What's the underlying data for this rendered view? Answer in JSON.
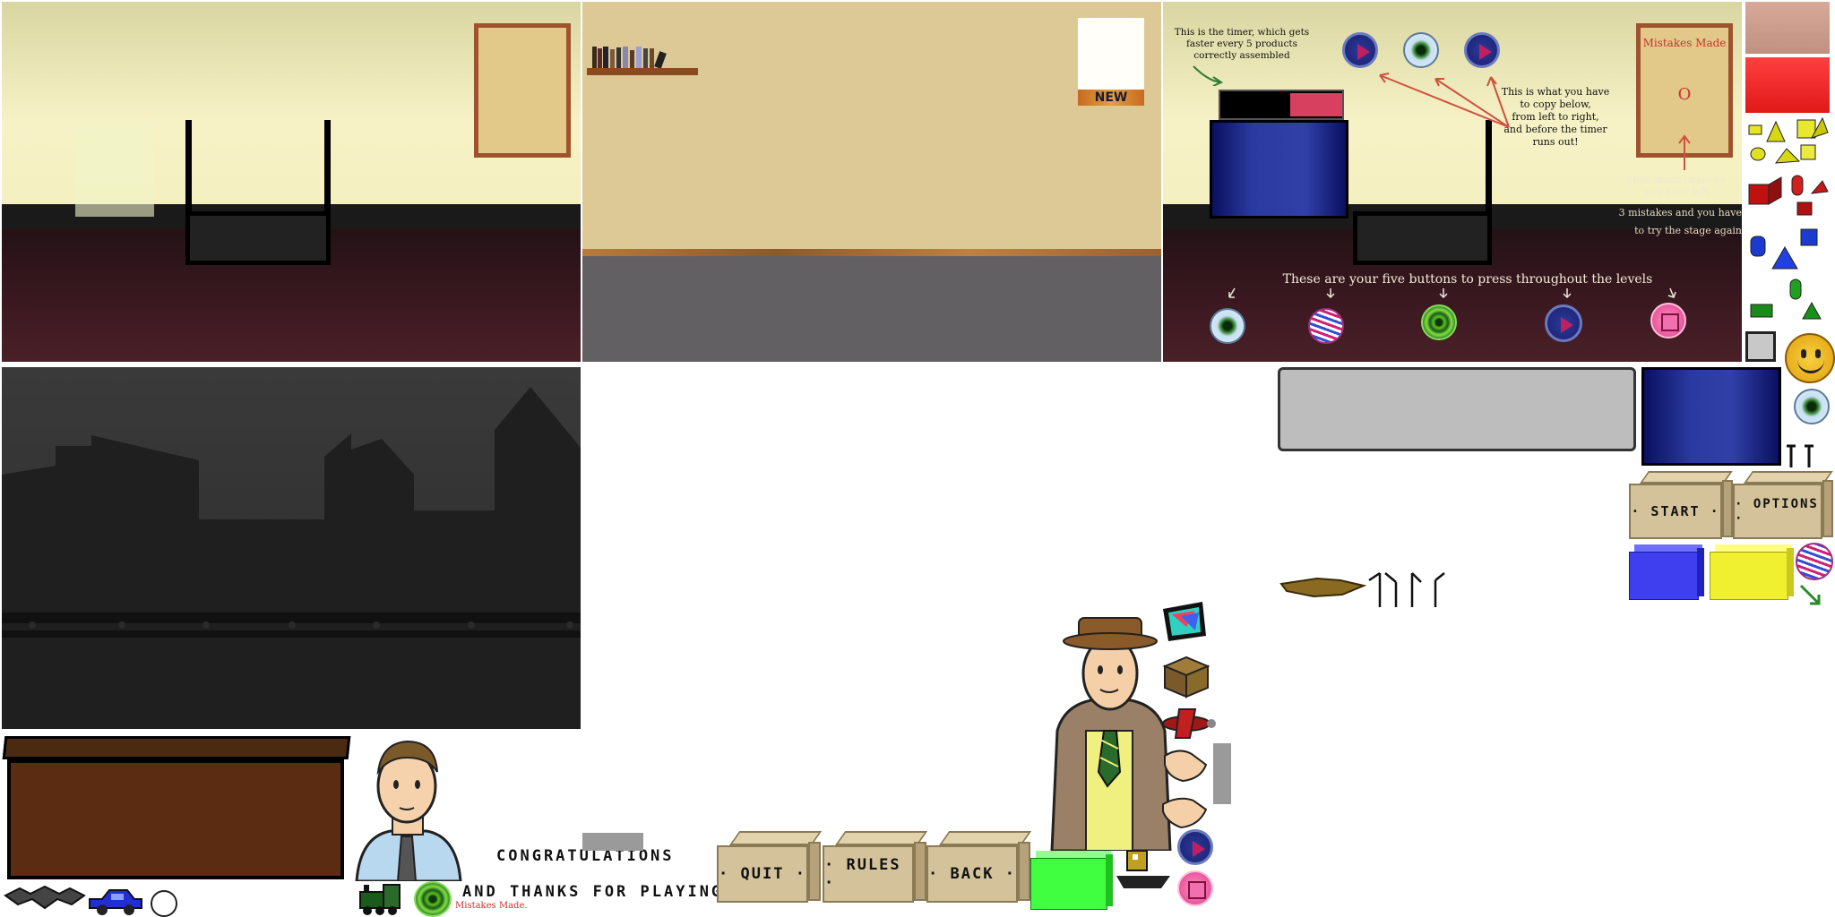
{
  "scene_tutorial": {
    "timer_note": [
      "This is the timer, which gets",
      "faster every 5 products",
      "correctly assembled"
    ],
    "copy_note": [
      "This is what you have",
      "to copy below,",
      "from left to right,",
      "and before the timer",
      "runs out!"
    ],
    "mistakes_board_title": "Mistakes Made",
    "mistakes_mark": "O",
    "chances_note": [
      "How many chances",
      "you have left"
    ],
    "mistakes_note": [
      "3 mistakes and you have",
      "to try the stage again"
    ],
    "buttons_note": "These are your five buttons to press throughout the levels"
  },
  "office_sign": "NEW",
  "menu": {
    "start_label": "· START ·",
    "options_label": "· OPTIONS ·",
    "quit_label": "· QUIT ·",
    "rules_label": "· RULES ·",
    "back_label": "· BACK ·"
  },
  "ending": {
    "congrats": "CONGRATULATIONS",
    "thanks": "AND THANKS FOR PLAYING!",
    "logo_text": "Mistakes Made."
  },
  "colors": {
    "wall_yellow": "#f4f0c0",
    "floor_dark": "#3a1820",
    "office_wall": "#ddc995",
    "office_floor": "#636063",
    "night_bg": "#2c2c2c",
    "desk_brown": "#5c2c12",
    "crate_tan": "#d4c29a",
    "timer_red": "#d84060",
    "blue_block": "#3f3ff0",
    "yellow_block": "#f0f030",
    "green_block": "#40ff40"
  },
  "icons": [
    "play-button-icon",
    "eye-button-icon",
    "target-button-icon",
    "swirl-button-icon",
    "square-button-icon",
    "smiley-icon",
    "car-icon",
    "bat-icon",
    "train-icon",
    "box-icon",
    "plane-icon",
    "boat-icon",
    "hand-icon",
    "shapes-icon"
  ]
}
